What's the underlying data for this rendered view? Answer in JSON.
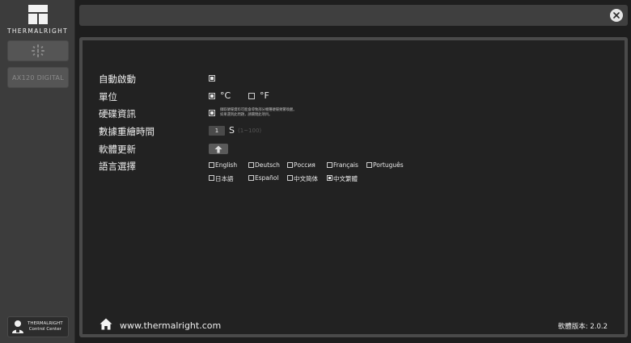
{
  "brand": {
    "logo_text": "THERMALRIGHT"
  },
  "sidebar": {
    "device_label": "AX120 DIGITAL",
    "control_center_line1": "THERMALRIGHT",
    "control_center_line2": "Control Center"
  },
  "settings": {
    "auto_start_label": "自動啟動",
    "unit_label": "單位",
    "unit_celsius": "°C",
    "unit_fahrenheit": "°F",
    "hardware_info_label": "硬碟資訊",
    "hardware_info_note_line1": "擷取硬碟資料可能會導致部分機種硬碟頻繁喚醒。",
    "hardware_info_note_line2": "如果遇到此問題，請關閉此項目。",
    "refresh_label": "數據重繪時間",
    "refresh_value": "1",
    "refresh_unit": "S",
    "refresh_range": "(1~100)",
    "update_label": "軟體更新",
    "language_label": "語言選擇",
    "languages": [
      "English",
      "Deutsch",
      "Россия",
      "Français",
      "Português",
      "日本語",
      "Español",
      "中文简体",
      "中文繁體"
    ],
    "selected_language": "中文繁體"
  },
  "footer": {
    "url": "www.thermalright.com",
    "version": "軟體版本: 2.0.2"
  }
}
